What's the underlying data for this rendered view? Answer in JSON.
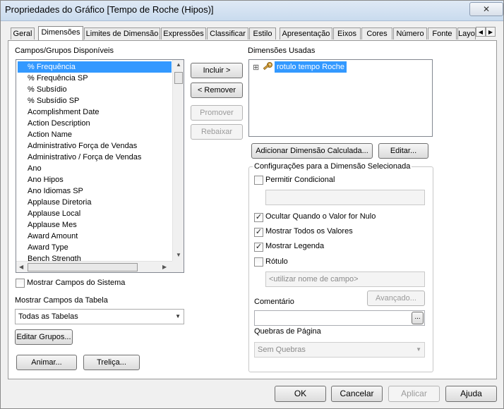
{
  "window": {
    "title": "Propriedades do Gráfico [Tempo de Roche (Hipos)]",
    "close_label": "✕"
  },
  "tabs": [
    {
      "label": "Geral"
    },
    {
      "label": "Dimensões"
    },
    {
      "label": "Limites de Dimensão"
    },
    {
      "label": "Expressões"
    },
    {
      "label": "Classificar"
    },
    {
      "label": "Estilo"
    },
    {
      "label": "Apresentação"
    },
    {
      "label": "Eixos"
    },
    {
      "label": "Cores"
    },
    {
      "label": "Número"
    },
    {
      "label": "Fonte"
    },
    {
      "label": "Layo"
    }
  ],
  "tab_scroll": {
    "left": "◀",
    "right": "▶"
  },
  "available": {
    "label": "Campos/Grupos Disponíveis",
    "items": [
      "% Frequência",
      "% Frequência SP",
      "% Subsídio",
      "% Subsídio SP",
      "Acomplishment Date",
      "Action Description",
      "Action Name",
      "Administrativo  Força de Vendas",
      "Administrativo / Força de Vendas",
      "Ano",
      "Ano Hipos",
      "Ano Idiomas SP",
      "Applause Diretoria",
      "Applause Local",
      "Applause Mes",
      "Award Amount",
      "Award Type",
      "Bench Strength"
    ],
    "selected_index": 0
  },
  "buttons": {
    "include": "Incluir >",
    "remove": "< Remover",
    "promote": "Promover",
    "demote": "Rebaixar",
    "add_calculated": "Adicionar Dimensão Calculada...",
    "edit": "Editar...",
    "edit_groups": "Editar Grupos...",
    "animate": "Animar...",
    "trellis": "Treliça...",
    "advanced": "Avançado...",
    "ellipsis": "..."
  },
  "used": {
    "label": "Dimensões Usadas",
    "items": [
      {
        "label": "rotulo tempo Roche",
        "expander": "⊞"
      }
    ]
  },
  "show_system_fields": {
    "label": "Mostrar Campos do Sistema",
    "checked": false
  },
  "table_fields": {
    "label": "Mostrar Campos da Tabela",
    "value": "Todas as Tabelas"
  },
  "settings": {
    "label": "Configurações para a Dimensão Selecionada",
    "conditional": {
      "label": "Permitir Condicional",
      "checked": false
    },
    "suppress_null": {
      "label": "Ocultar Quando o Valor for Nulo",
      "checked": true
    },
    "show_all": {
      "label": "Mostrar Todos os Valores",
      "checked": true
    },
    "show_legend": {
      "label": "Mostrar Legenda",
      "checked": true
    },
    "label_field": {
      "label": "Rótulo",
      "checked": false,
      "placeholder": "<utilizar nome de campo>"
    },
    "comment": {
      "label": "Comentário"
    },
    "page_breaks": {
      "label": "Quebras de Página",
      "value": "Sem Quebras"
    }
  },
  "check_mark": "✓",
  "dialog": {
    "ok": "OK",
    "cancel": "Cancelar",
    "apply": "Aplicar",
    "help": "Ajuda"
  }
}
